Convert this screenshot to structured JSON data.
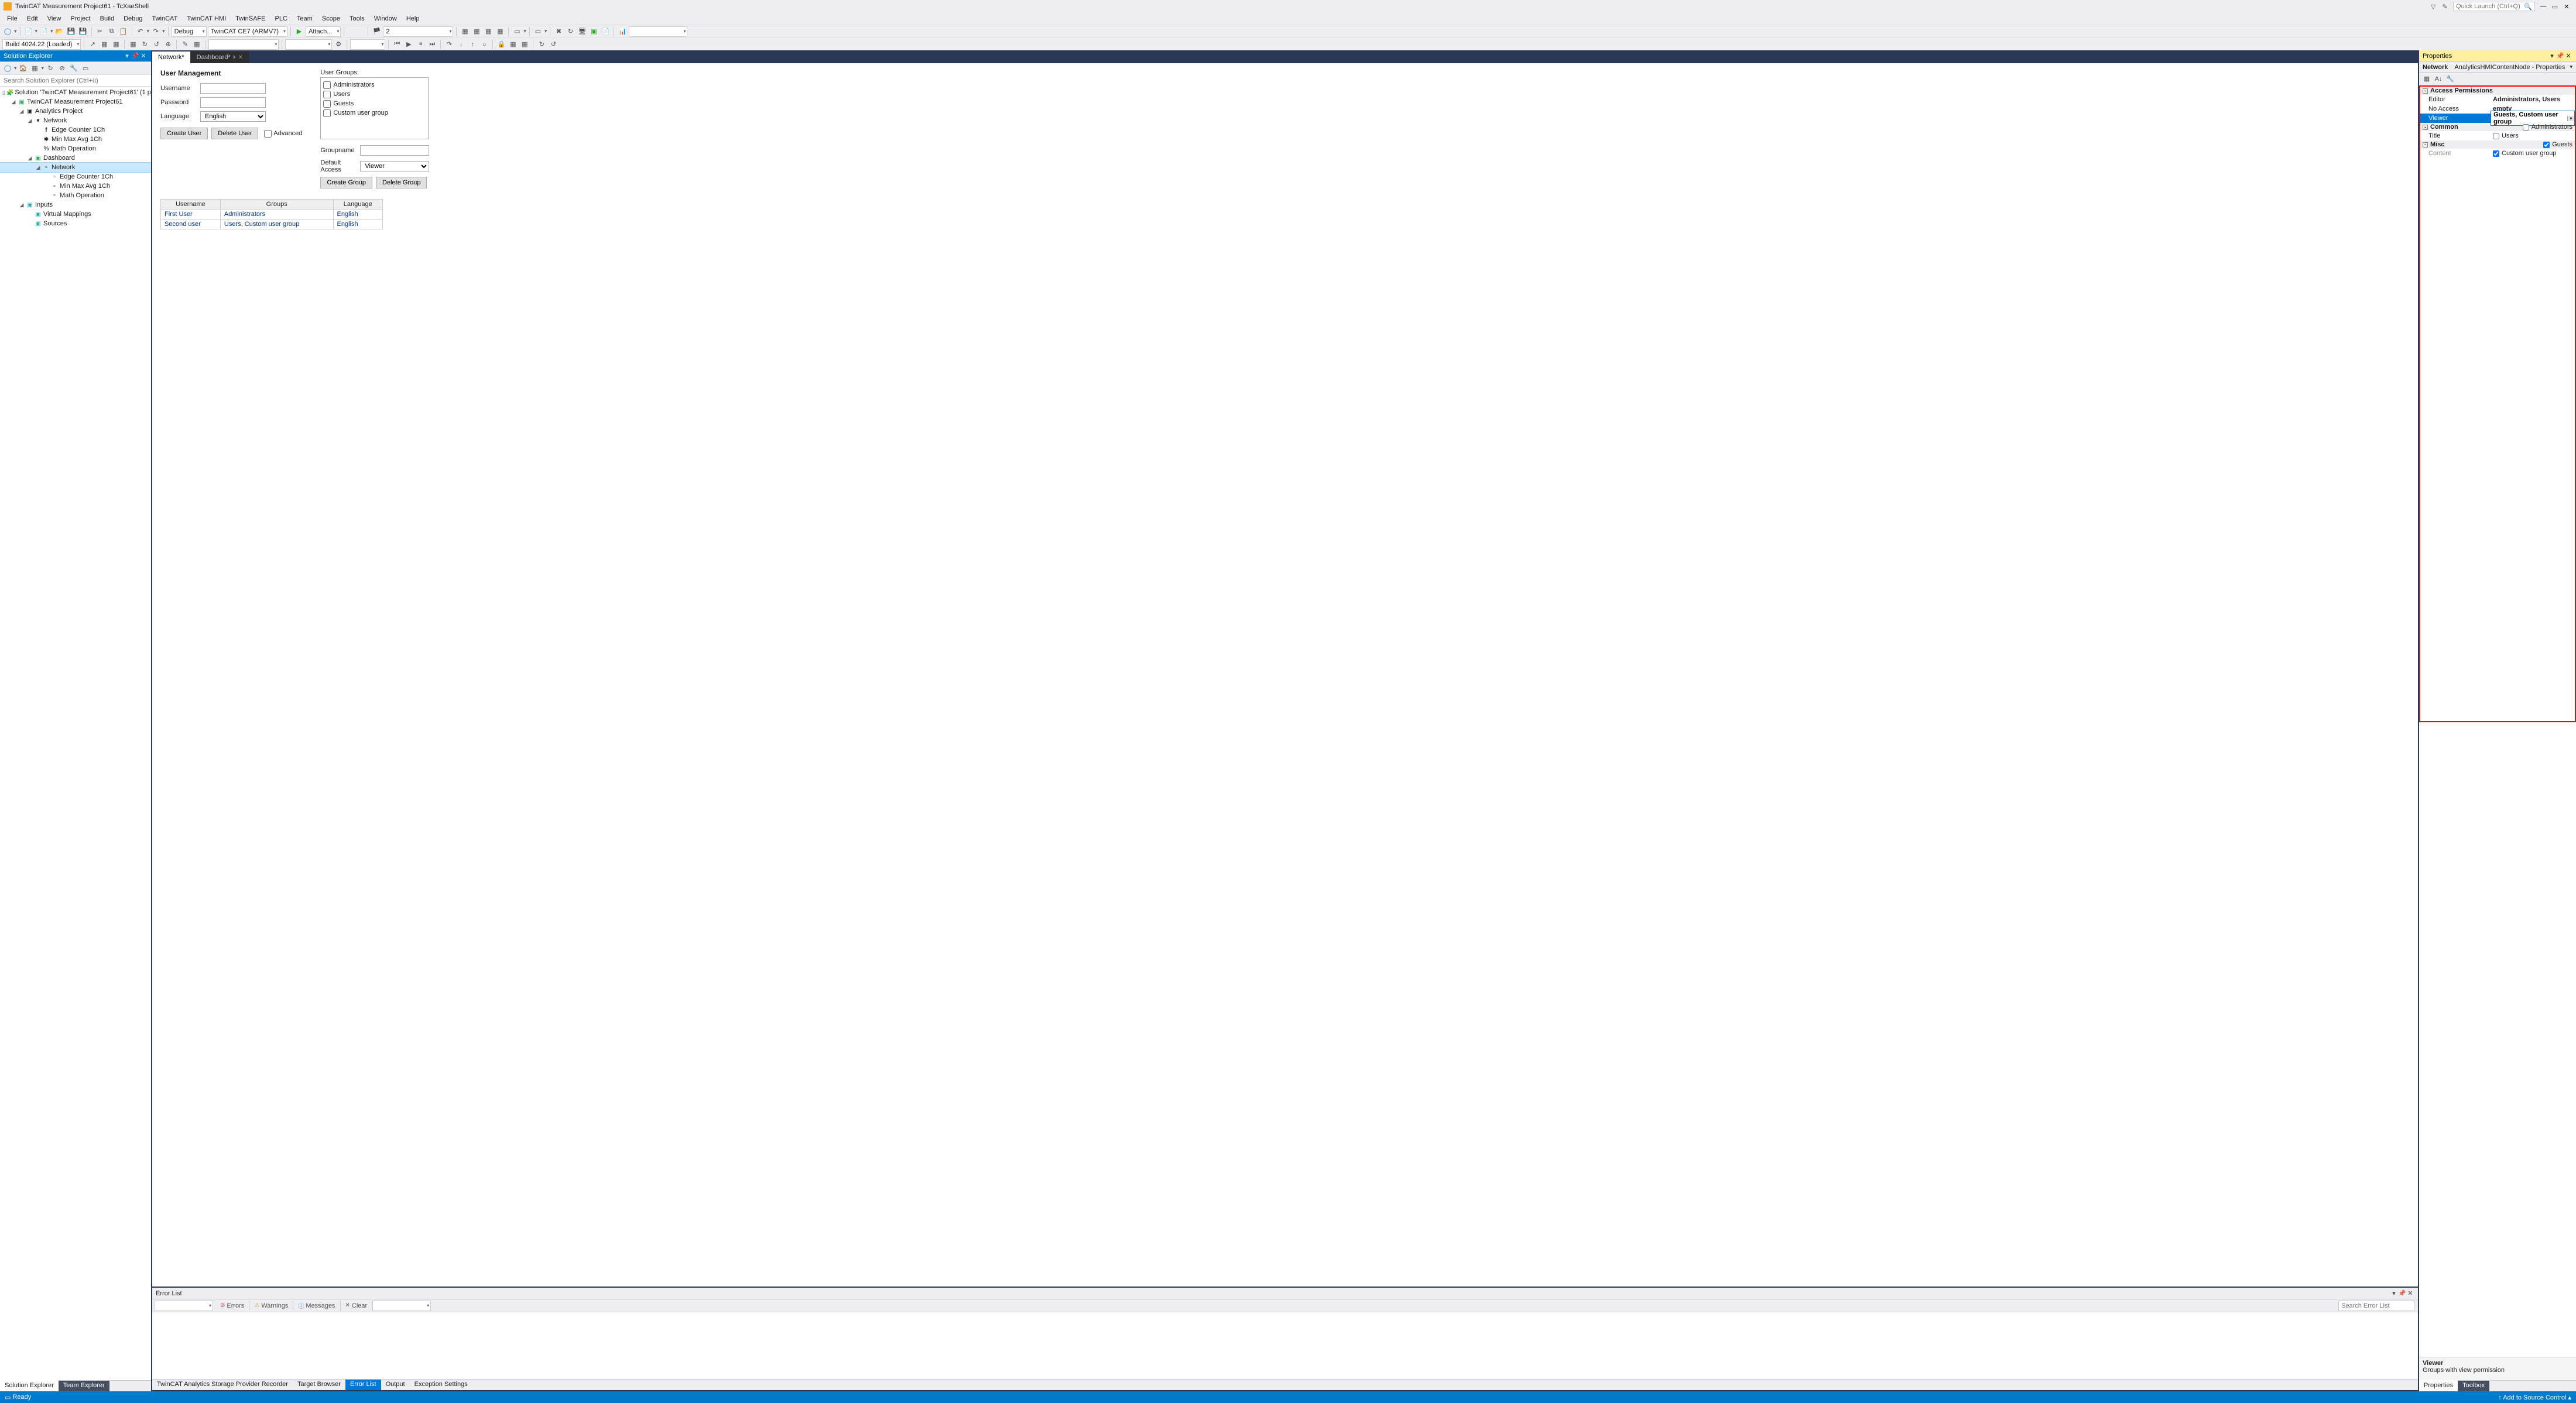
{
  "title": "TwinCAT Measurement Project61 - TcXaeShell",
  "quickLaunch": "Quick Launch (Ctrl+Q)",
  "menu": [
    "File",
    "Edit",
    "View",
    "Project",
    "Build",
    "Debug",
    "TwinCAT",
    "TwinCAT HMI",
    "TwinSAFE",
    "PLC",
    "Team",
    "Scope",
    "Tools",
    "Window",
    "Help"
  ],
  "toolbar1": {
    "config": "Debug",
    "platform": "TwinCAT CE7 (ARMV7)",
    "attach": "Attach...",
    "num": "2"
  },
  "toolbar2": {
    "build": "Build 4024.22 (Loaded)"
  },
  "solEx": {
    "title": "Solution Explorer",
    "search": "Search Solution Explorer (Ctrl+ü)",
    "nodes": {
      "sol": "Solution 'TwinCAT Measurement Project61' (1 project)",
      "proj": "TwinCAT Measurement Project61",
      "ana": "Analytics Project",
      "net1": "Network",
      "ec1": "Edge Counter 1Ch",
      "mm1": "Min Max Avg 1Ch",
      "mo1": "Math Operation",
      "dash": "Dashboard",
      "net2": "Network",
      "ec2": "Edge Counter 1Ch",
      "mm2": "Min Max Avg 1Ch",
      "mo2": "Math Operation",
      "inp": "Inputs",
      "vm": "Virtual Mappings",
      "src": "Sources"
    }
  },
  "tabs": {
    "t0": "Network*",
    "t1": "Dashboard*"
  },
  "um": {
    "title": "User Management",
    "username": "Username",
    "password": "Password",
    "language": "Language:",
    "langval": "English",
    "usergroups": "User Groups:",
    "groups": [
      "Administrators",
      "Users",
      "Guests",
      "Custom user group"
    ],
    "createUser": "Create User",
    "deleteUser": "Delete User",
    "advanced": "Advanced",
    "groupname": "Groupname",
    "defaultAccess": "Default Access",
    "defaultAccessVal": "Viewer",
    "createGroup": "Create Group",
    "deleteGroup": "Delete Group",
    "th": [
      "Username",
      "Groups",
      "Language"
    ],
    "rows": [
      {
        "u": "First User",
        "g": "Administrators",
        "l": "English"
      },
      {
        "u": "Second user",
        "g": "Users, Custom user group",
        "l": "English"
      }
    ]
  },
  "errList": {
    "title": "Error List",
    "errors": "Errors",
    "warnings": "Warnings",
    "messages": "Messages",
    "clear": "Clear",
    "search": "Search Error List"
  },
  "props": {
    "title": "Properties",
    "objLabel": "Network",
    "objType": "AnalyticsHMIContentNode - Properties",
    "cats": {
      "access": "Access Permissions",
      "common": "Common",
      "misc": "Misc"
    },
    "access": {
      "editor": "Editor",
      "editorV": "Administrators, Users",
      "noaccess": "No Access",
      "noaccessV": "empty",
      "viewer": "Viewer",
      "viewerV": "Guests, Custom user group"
    },
    "viewerOpts": {
      "admin": "Administrators",
      "users": "Users",
      "guests": "Guests",
      "custom": "Custom user group"
    },
    "common": {
      "titleK": "Title"
    },
    "misc": {
      "contentK": "Content"
    },
    "desc": {
      "h": "Viewer",
      "b": "Groups with view permission"
    }
  },
  "bottomTabs": {
    "left": [
      "Solution Explorer",
      "Team Explorer"
    ],
    "centerDoc": [
      "TwinCAT Analytics Storage Provider Recorder",
      "Target Browser",
      "Error List",
      "Output",
      "Exception Settings"
    ],
    "right": [
      "Properties",
      "Toolbox"
    ]
  },
  "status": {
    "ready": "Ready",
    "addsc": "Add to Source Control"
  }
}
